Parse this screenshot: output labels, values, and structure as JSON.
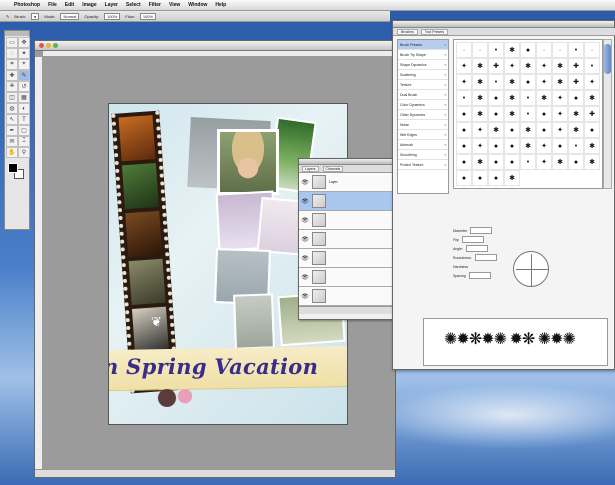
{
  "menubar": {
    "apple": "",
    "items": [
      "Photoshop",
      "File",
      "Edit",
      "Image",
      "Layer",
      "Select",
      "Filter",
      "View",
      "Window",
      "Help"
    ]
  },
  "options_bar": {
    "brush_label": "Brush:",
    "mode_label": "Mode:",
    "mode_value": "Normal",
    "opacity_label": "Opacity:",
    "opacity_value": "100%",
    "flow_label": "Flow:",
    "flow_value": "100%"
  },
  "toolbox": {
    "tools": [
      "marquee-icon",
      "move-icon",
      "lasso-icon",
      "magic-wand-icon",
      "crop-icon",
      "slice-icon",
      "heal-icon",
      "brush-icon",
      "stamp-icon",
      "history-brush-icon",
      "eraser-icon",
      "gradient-icon",
      "blur-icon",
      "dodge-icon",
      "path-select-icon",
      "type-icon",
      "pen-icon",
      "shape-icon",
      "notes-icon",
      "eyedropper-icon",
      "hand-icon",
      "zoom-icon"
    ],
    "tool_glyphs": [
      "▭",
      "✥",
      "◌",
      "✦",
      "⌗",
      "⌖",
      "✚",
      "✎",
      "⎈",
      "↺",
      "◫",
      "▦",
      "◍",
      "◐",
      "↖",
      "T",
      "✒",
      "▢",
      "✉",
      "⌶",
      "✋",
      "⚲"
    ],
    "foreground_color": "#000000",
    "background_color": "#ffffff"
  },
  "document": {
    "title": "",
    "status": "",
    "artwork": {
      "banner_text": "n Spring Vacation"
    }
  },
  "layers_palette": {
    "tabs": [
      "Layers",
      "Channels"
    ],
    "layers": [
      {
        "name": "Layer",
        "visible": true,
        "active": false
      },
      {
        "name": "",
        "visible": true,
        "active": true
      },
      {
        "name": "",
        "visible": true,
        "active": false
      },
      {
        "name": "",
        "visible": true,
        "active": false
      },
      {
        "name": "",
        "visible": true,
        "active": false
      },
      {
        "name": "",
        "visible": true,
        "active": false
      },
      {
        "name": "",
        "visible": true,
        "active": false
      }
    ],
    "eye_glyph": "👁"
  },
  "brushes_palette": {
    "tabs": [
      "Brushes",
      "Tool Presets"
    ],
    "options": [
      {
        "label": "Brush Presets",
        "selected": true
      },
      {
        "label": "Brush Tip Shape",
        "selected": false
      },
      {
        "label": "Shape Dynamics",
        "selected": false
      },
      {
        "label": "Scattering",
        "selected": false
      },
      {
        "label": "Texture",
        "selected": false
      },
      {
        "label": "Dual Brush",
        "selected": false
      },
      {
        "label": "Color Dynamics",
        "selected": false
      },
      {
        "label": "Other Dynamics",
        "selected": false
      },
      {
        "label": "Noise",
        "selected": false
      },
      {
        "label": "Wet Edges",
        "selected": false
      },
      {
        "label": "Airbrush",
        "selected": false
      },
      {
        "label": "Smoothing",
        "selected": false
      },
      {
        "label": "Protect Texture",
        "selected": false
      }
    ],
    "brush_glyphs": [
      "·",
      "·",
      "•",
      "✱",
      "●",
      "·",
      "·",
      "•",
      "·",
      "✦",
      "✱",
      "✚",
      "✦",
      "✱",
      "✦",
      "✱",
      "✚",
      "•",
      "✦",
      "✱",
      "•",
      "✱",
      "●",
      "✦",
      "✱",
      "✚",
      "✦",
      "•",
      "✱",
      "●",
      "✱",
      "•",
      "✱",
      "✦",
      "●",
      "✱",
      "●",
      "✱",
      "●",
      "✱",
      "•",
      "●",
      "✦",
      "✱",
      "✚",
      "●",
      "✦",
      "✱",
      "●",
      "✱",
      "●",
      "✦",
      "✱",
      "●",
      "●",
      "✦",
      "●",
      "●",
      "✱",
      "✦",
      "●",
      "•",
      "✱",
      "●",
      "✱",
      "●",
      "●",
      "•",
      "✦",
      "✱",
      "●",
      "✱",
      "●",
      "●",
      "●",
      "✱"
    ],
    "settings": {
      "diameter_label": "Diameter",
      "flip_label": "Flip",
      "angle_label": "Angle:",
      "roundness_label": "Roundness:",
      "hardness_label": "Hardness",
      "spacing_label": "Spacing"
    },
    "preview_marks": "✺✹❋✹✺ ✹❋ ✺✹✺"
  }
}
